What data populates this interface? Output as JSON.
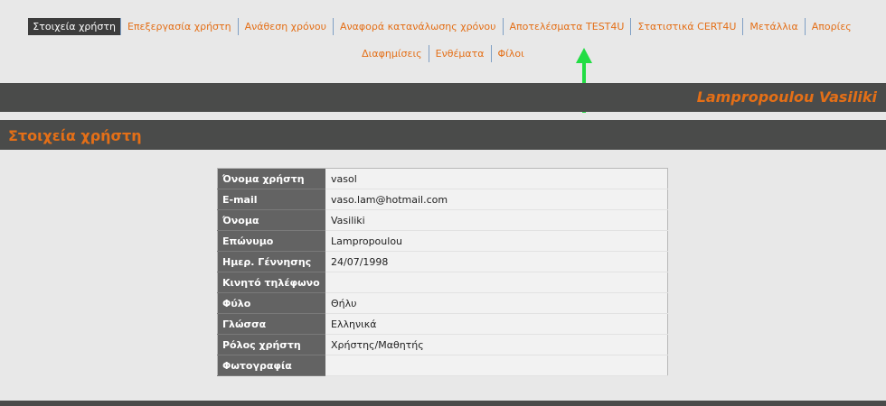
{
  "nav": {
    "row1": [
      "Στοιχεία χρήστη",
      "Επεξεργασία χρήστη",
      "Ανάθεση χρόνου",
      "Αναφορά κατανάλωσης χρόνου",
      "Αποτελέσματα TEST4U",
      "Στατιστικά CERT4U",
      "Μετάλλια",
      "Απορίες"
    ],
    "row2": [
      "Διαφημίσεις",
      "Ενθέματα",
      "Φίλοι"
    ],
    "active_index": 0
  },
  "user": {
    "name": "Lampropoulou Vasiliki"
  },
  "section": {
    "title": "Στοιχεία χρήστη"
  },
  "profile": {
    "rows": [
      {
        "label": "Όνομα χρήστη",
        "value": "vasol"
      },
      {
        "label": "E-mail",
        "value": "vaso.lam@hotmail.com"
      },
      {
        "label": "Όνομα",
        "value": "Vasiliki"
      },
      {
        "label": "Επώνυμο",
        "value": "Lampropoulou"
      },
      {
        "label": "Ημερ. Γέννησης",
        "value": "24/07/1998"
      },
      {
        "label": "Κινητό τηλέφωνο",
        "value": ""
      },
      {
        "label": "Φύλο",
        "value": "Θήλυ"
      },
      {
        "label": "Γλώσσα",
        "value": "Ελληνικά"
      },
      {
        "label": "Ρόλος χρήστη",
        "value": "Χρήστης/Μαθητής"
      },
      {
        "label": "Φωτογραφία",
        "value": ""
      }
    ]
  },
  "colors": {
    "accent": "#e46f17",
    "bar": "#4a4b4a",
    "label_bg": "#636363",
    "arrow": "#22dd44"
  },
  "icons": {
    "annotation": "arrow-up-icon"
  }
}
